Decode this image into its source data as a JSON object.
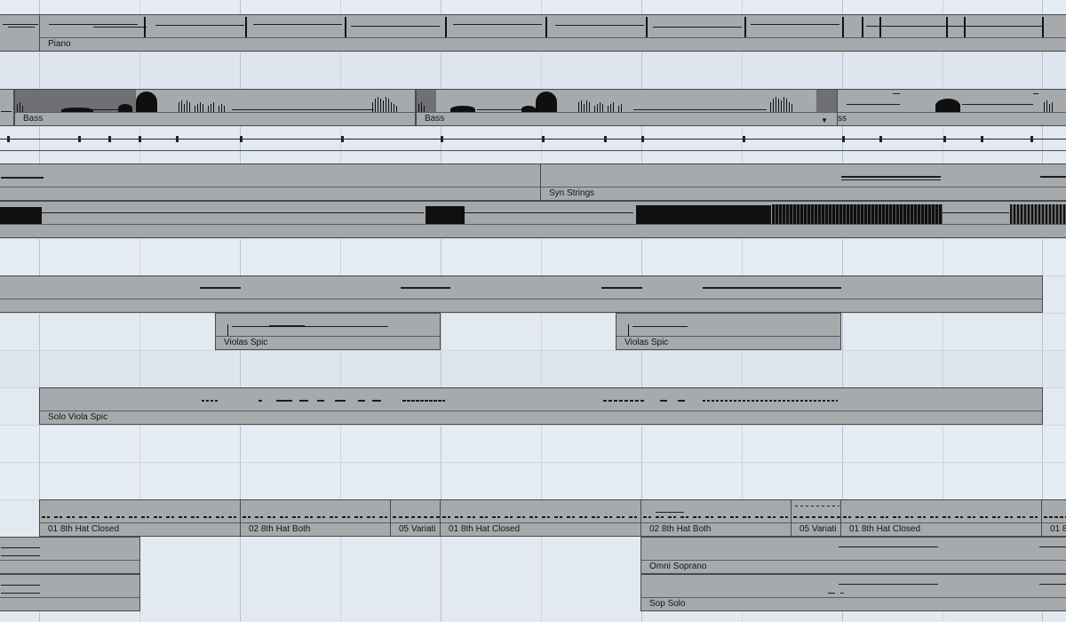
{
  "tracks": [
    {
      "name": "piano",
      "parts": [
        {
          "label": "Piano"
        }
      ]
    },
    {
      "name": "bass",
      "parts": [
        {
          "label": "Bass"
        },
        {
          "label": "Bass"
        },
        {
          "label": "ss"
        }
      ]
    },
    {
      "name": "syn-strings",
      "parts": [
        {
          "label": ""
        },
        {
          "label": "Syn Strings"
        }
      ]
    },
    {
      "name": "violas-spic",
      "parts": [
        {
          "label": "Violas Spic"
        },
        {
          "label": "Violas Spic"
        }
      ]
    },
    {
      "name": "solo-viola",
      "parts": [
        {
          "label": "Solo Viola Spic"
        }
      ]
    },
    {
      "name": "hats",
      "parts": [
        {
          "label": "01 8th Hat Closed"
        },
        {
          "label": "02 8th Hat Both"
        },
        {
          "label": "05 Variati"
        },
        {
          "label": "01 8th Hat Closed"
        },
        {
          "label": "02 8th Hat Both"
        },
        {
          "label": "05 Variati"
        },
        {
          "label": "01 8th Hat Closed"
        },
        {
          "label": "01 8"
        }
      ]
    },
    {
      "name": "omni-soprano",
      "parts": [
        {
          "label": ""
        },
        {
          "label": "Omni Soprano"
        }
      ]
    },
    {
      "name": "sop-solo",
      "parts": [
        {
          "label": ""
        },
        {
          "label": "Sop Solo"
        }
      ]
    }
  ],
  "icons": {
    "part_menu": "chevron-down-icon"
  },
  "colors": {
    "background": "#e3e9f1",
    "part_fill": "#a7aaad",
    "part_border": "#46494d",
    "note": "#1c1c1c"
  }
}
